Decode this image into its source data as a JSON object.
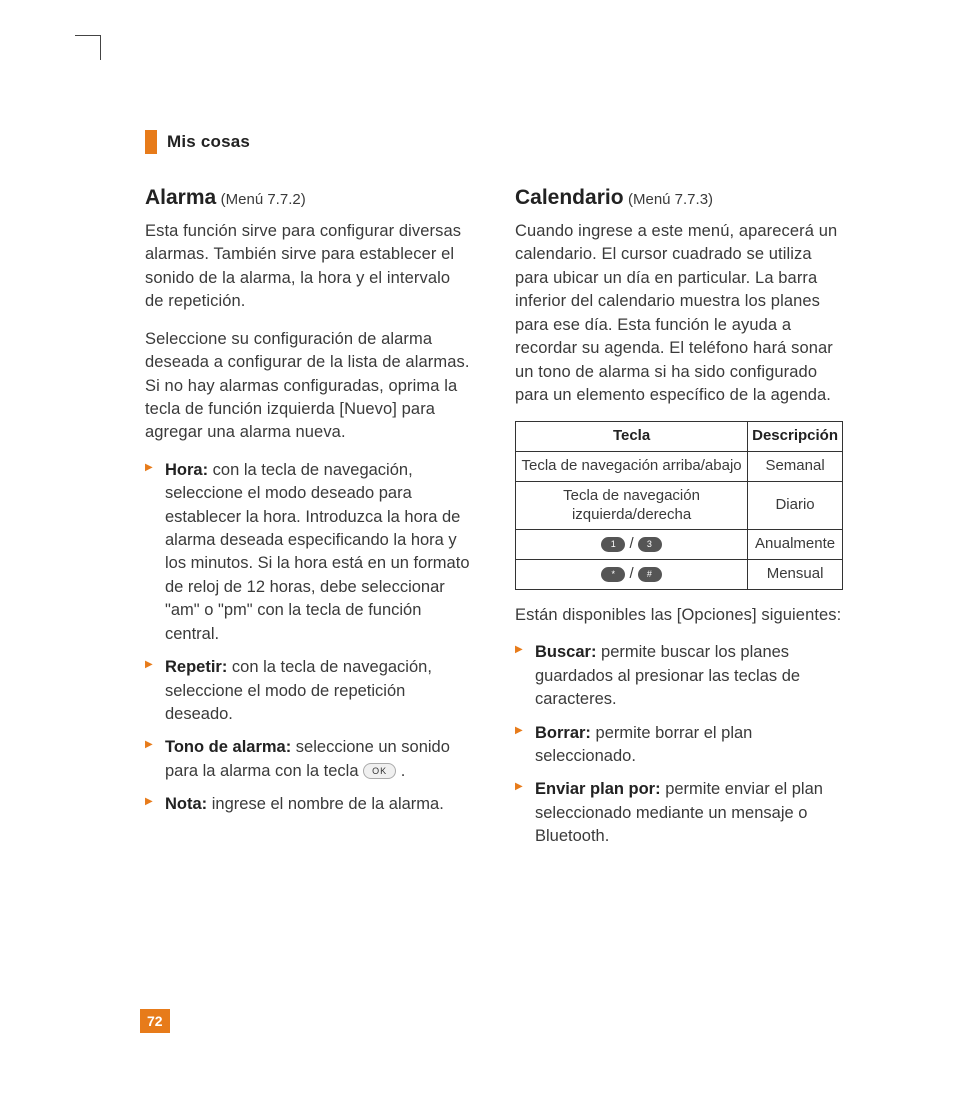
{
  "section": "Mis cosas",
  "page_number": "72",
  "left": {
    "heading": "Alarma",
    "menu_ref": "(Menú 7.7.2)",
    "para1": "Esta función sirve para configurar diversas alarmas. También sirve para establecer el sonido de la alarma, la hora y el intervalo de repetición.",
    "para2": "Seleccione su configuración de alarma deseada a configurar de la lista de alarmas. Si no hay alarmas configuradas, oprima la tecla de función izquierda [Nuevo] para agregar una alarma nueva.",
    "items": [
      {
        "label": "Hora:",
        "text": " con la tecla de navegación, seleccione el modo deseado para establecer la hora. Introduzca la hora de alarma deseada especificando la hora y los minutos. Si la hora está en un formato de reloj de 12 horas, debe seleccionar \"am\" o \"pm\" con la tecla de función central."
      },
      {
        "label": "Repetir:",
        "text": " con la tecla de navegación, seleccione el modo de repetición deseado."
      },
      {
        "label": "Tono de alarma:",
        "text_before": " seleccione un sonido para la alarma con la tecla ",
        "ok": "OK",
        "text_after": " ."
      },
      {
        "label": "Nota:",
        "text": " ingrese el nombre de la alarma."
      }
    ]
  },
  "right": {
    "heading": "Calendario",
    "menu_ref": "(Menú 7.7.3)",
    "para1": "Cuando ingrese a este menú, aparecerá un calendario. El cursor cuadrado se utiliza para ubicar un día en particular. La barra inferior del calendario muestra los planes para ese día. Esta función le ayuda a recordar su agenda. El teléfono hará sonar un tono de alarma si ha sido configurado para un elemento específico de la agenda.",
    "table": {
      "headers": [
        "Tecla",
        "Descripción"
      ],
      "rows": [
        {
          "key": "Tecla de navegación arriba/abajo",
          "desc": "Semanal"
        },
        {
          "key": "Tecla de navegación izquierda/derecha",
          "desc": "Diario"
        },
        {
          "key_btns": [
            "1",
            "3"
          ],
          "desc": "Anualmente"
        },
        {
          "key_btns": [
            "*",
            "#"
          ],
          "desc": "Mensual"
        }
      ]
    },
    "para2": "Están disponibles las [Opciones] siguientes:",
    "items": [
      {
        "label": "Buscar:",
        "text": " permite buscar los planes guardados al presionar las teclas de caracteres."
      },
      {
        "label": "Borrar:",
        "text": " permite borrar el plan seleccionado."
      },
      {
        "label": "Enviar plan por:",
        "text": " permite enviar el plan seleccionado mediante un mensaje o Bluetooth."
      }
    ]
  }
}
